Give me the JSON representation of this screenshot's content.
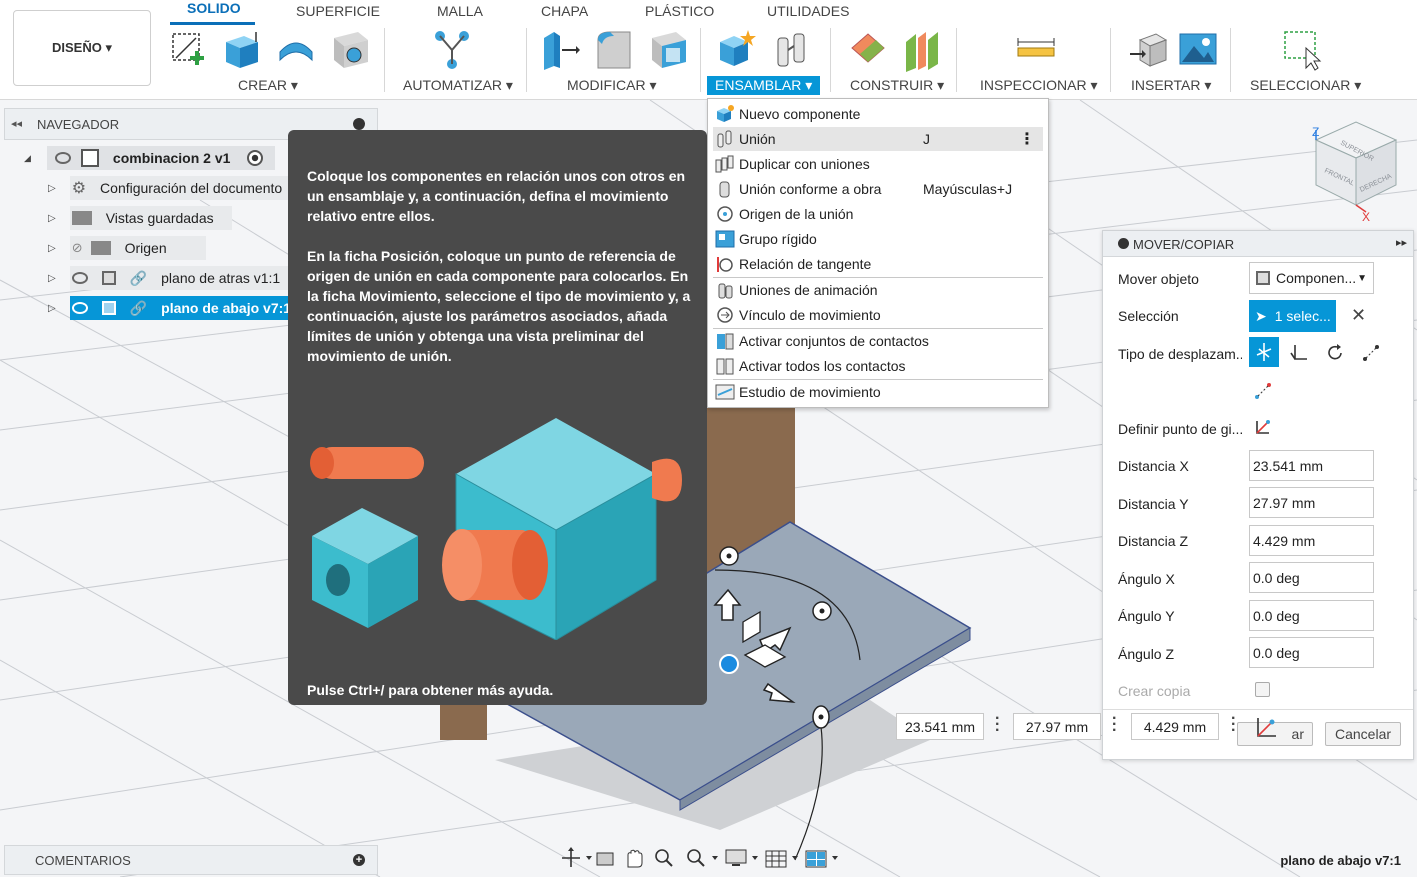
{
  "toolbar": {
    "design_button": "DISEÑO ▾",
    "tabs": [
      "SOLIDO",
      "SUPERFICIE",
      "MALLA",
      "CHAPA",
      "PLÁSTICO",
      "UTILIDADES"
    ],
    "groups": [
      "CREAR ▾",
      "AUTOMATIZAR ▾",
      "MODIFICAR ▾",
      "ENSAMBLAR ▾",
      "CONSTRUIR ▾",
      "INSPECCIONAR ▾",
      "INSERTAR ▾",
      "SELECCIONAR ▾"
    ],
    "active_color": "#0696d7"
  },
  "navigator": {
    "title": "NAVEGADOR",
    "root": "combinacion 2 v1",
    "items": [
      "Configuración del documento",
      "Vistas guardadas",
      "Origen",
      "plano de atras v1:1",
      "plano de abajo v7:1"
    ]
  },
  "tooltip": {
    "p1": "Coloque los componentes en relación unos con otros en un ensamblaje y, a continuación, defina el movimiento relativo entre ellos.",
    "p2": "En la ficha Posición, coloque un punto de referencia de origen de unión en cada componente para colocarlos. En la ficha Movimiento, seleccione el tipo de movimiento y, a continuación, ajuste los parámetros asociados, añada límites de unión y obtenga una vista preliminar del movimiento de unión.",
    "footer": "Pulse Ctrl+/ para obtener más ayuda."
  },
  "menu": {
    "items": [
      {
        "label": "Nuevo componente",
        "shortcut": ""
      },
      {
        "label": "Unión",
        "shortcut": "J"
      },
      {
        "label": "Duplicar con uniones",
        "shortcut": ""
      },
      {
        "label": "Unión conforme a obra",
        "shortcut": "Mayúsculas+J"
      },
      {
        "label": "Origen de la unión",
        "shortcut": ""
      },
      {
        "label": "Grupo rígido",
        "shortcut": ""
      },
      {
        "label": "Relación de tangente",
        "shortcut": ""
      },
      {
        "label": "Uniones de animación",
        "shortcut": ""
      },
      {
        "label": "Vínculo de movimiento",
        "shortcut": ""
      },
      {
        "label": "Activar conjuntos de contactos",
        "shortcut": ""
      },
      {
        "label": "Activar todos los contactos",
        "shortcut": ""
      },
      {
        "label": "Estudio de movimiento",
        "shortcut": ""
      }
    ]
  },
  "panel": {
    "title": "MOVER/COPIAR",
    "move_object_label": "Mover objeto",
    "move_object_value": "Componen...",
    "selection_label": "Selección",
    "selection_value": "1 selec...",
    "move_type_label": "Tipo de desplazam...",
    "pivot_label": "Definir punto de gi...",
    "fields": [
      {
        "label": "Distancia X",
        "value": "23.541 mm"
      },
      {
        "label": "Distancia Y",
        "value": "27.97 mm"
      },
      {
        "label": "Distancia Z",
        "value": "4.429 mm"
      },
      {
        "label": "Ángulo X",
        "value": "0.0 deg"
      },
      {
        "label": "Ángulo Y",
        "value": "0.0 deg"
      },
      {
        "label": "Ángulo Z",
        "value": "0.0 deg"
      }
    ],
    "create_copy_label": "Crear copia",
    "ok_label": "ar",
    "cancel_label": "Cancelar"
  },
  "viewport": {
    "dim_x": "23.541 mm",
    "dim_y": "27.97 mm",
    "dim_z": "4.429 mm",
    "viewcube": {
      "top": "SUPERIOR",
      "front": "FRONTAL",
      "right": "DERECHA",
      "axis_z": "Z",
      "axis_x": "X"
    }
  },
  "bottom": {
    "comments": "COMENTARIOS",
    "status": "plano de abajo v7:1"
  }
}
